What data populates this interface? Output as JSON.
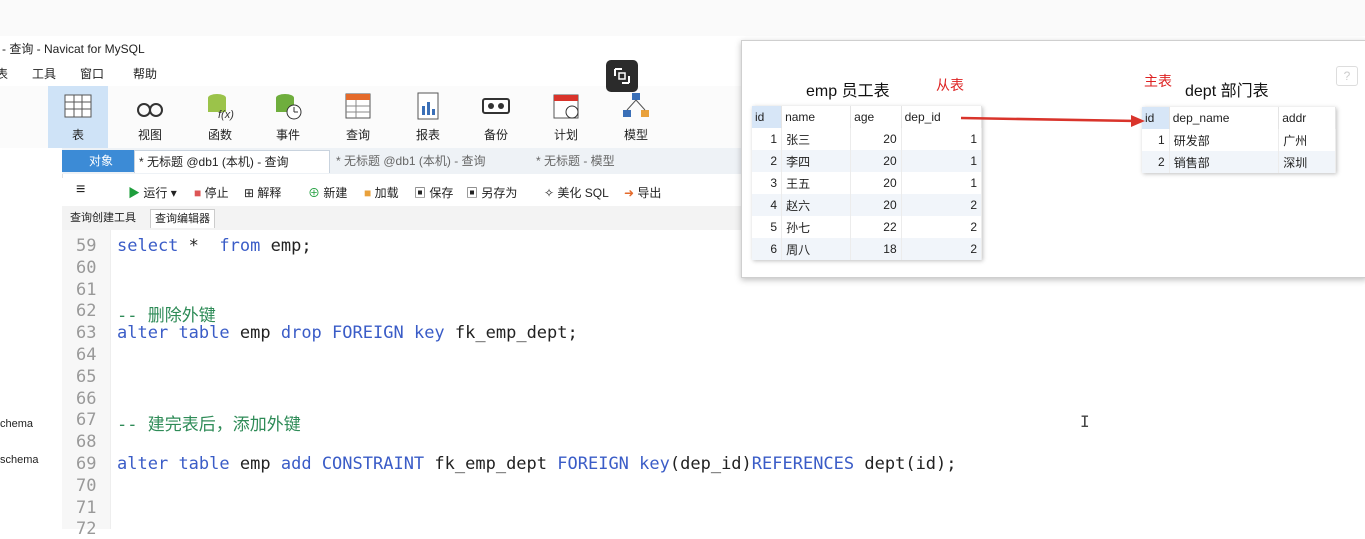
{
  "window": {
    "title": "- 查询 - Navicat for MySQL"
  },
  "menu": [
    "表",
    "工具",
    "窗口",
    "帮助"
  ],
  "toolbar": [
    {
      "label": "表",
      "icon": "table-icon"
    },
    {
      "label": "视图",
      "icon": "view-icon"
    },
    {
      "label": "函数",
      "icon": "function-icon"
    },
    {
      "label": "事件",
      "icon": "event-icon"
    },
    {
      "label": "查询",
      "icon": "query-icon"
    },
    {
      "label": "报表",
      "icon": "report-icon"
    },
    {
      "label": "备份",
      "icon": "backup-icon"
    },
    {
      "label": "计划",
      "icon": "schedule-icon"
    },
    {
      "label": "模型",
      "icon": "model-icon"
    }
  ],
  "tabs": [
    "对象",
    "* 无标题 @db1 (本机) - 查询",
    "* 无标题 @db1 (本机) - 查询",
    "* 无标题 - 模型"
  ],
  "actions": {
    "menu": "≡",
    "run": "运行",
    "stop": "停止",
    "explain": "解释",
    "new": "新建",
    "load": "加载",
    "save": "保存",
    "save_as": "另存为",
    "beautify": "美化 SQL",
    "export": "导出"
  },
  "subtabs": [
    "查询创建工具",
    "查询编辑器"
  ],
  "left_panel": [
    "chema",
    "schema"
  ],
  "editor": {
    "lines": [
      {
        "n": "59",
        "parts": [
          [
            "kw",
            "select"
          ],
          [
            "",
            "* "
          ],
          [
            "kw",
            "from"
          ],
          [
            "",
            "emp;"
          ]
        ]
      },
      {
        "n": "60",
        "parts": []
      },
      {
        "n": "61",
        "parts": []
      },
      {
        "n": "62",
        "parts": [
          [
            "cm",
            "-- 删除外键"
          ]
        ]
      },
      {
        "n": "63",
        "parts": [
          [
            "kw",
            "alter"
          ],
          [
            "kw",
            "table"
          ],
          [
            "",
            "emp"
          ],
          [
            "kw",
            "drop"
          ],
          [
            "kw",
            "FOREIGN"
          ],
          [
            "kw",
            "key"
          ],
          [
            "",
            "fk_emp_dept;"
          ]
        ]
      },
      {
        "n": "64",
        "parts": []
      },
      {
        "n": "65",
        "parts": []
      },
      {
        "n": "66",
        "parts": []
      },
      {
        "n": "67",
        "parts": [
          [
            "cm",
            "-- 建完表后，添加外键"
          ]
        ]
      },
      {
        "n": "68",
        "parts": []
      },
      {
        "n": "69",
        "parts": [
          [
            "kw",
            "alter"
          ],
          [
            "kw",
            "table"
          ],
          [
            "",
            "emp"
          ],
          [
            "kw",
            "add"
          ],
          [
            "kw",
            "CONSTRAINT"
          ],
          [
            "",
            "fk_emp_dept"
          ],
          [
            "kw",
            "FOREIGN"
          ],
          [
            "kw",
            "key"
          ],
          [
            "",
            "(dep_id)"
          ],
          [
            "kw",
            "REFERENCES"
          ],
          [
            "",
            "dept(id);"
          ]
        ]
      },
      {
        "n": "70",
        "parts": []
      },
      {
        "n": "71",
        "parts": []
      },
      {
        "n": "72",
        "parts": []
      }
    ]
  },
  "diagram": {
    "emp_caption": "emp 员工表",
    "emp_role": "从表",
    "dept_caption": "dept 部门表",
    "dept_role": "主表",
    "emp_columns": [
      "id",
      "name",
      "age",
      "dep_id"
    ],
    "emp_rows": [
      [
        "1",
        "张三",
        "20",
        "1"
      ],
      [
        "2",
        "李四",
        "20",
        "1"
      ],
      [
        "3",
        "王五",
        "20",
        "1"
      ],
      [
        "4",
        "赵六",
        "20",
        "2"
      ],
      [
        "5",
        "孙七",
        "22",
        "2"
      ],
      [
        "6",
        "周八",
        "18",
        "2"
      ]
    ],
    "dept_columns": [
      "id",
      "dep_name",
      "addr"
    ],
    "dept_rows": [
      [
        "1",
        "研发部",
        "广州"
      ],
      [
        "2",
        "销售部",
        "深圳"
      ]
    ],
    "arrow_color": "#d9342b"
  },
  "help_label": "?",
  "cursor": "I"
}
